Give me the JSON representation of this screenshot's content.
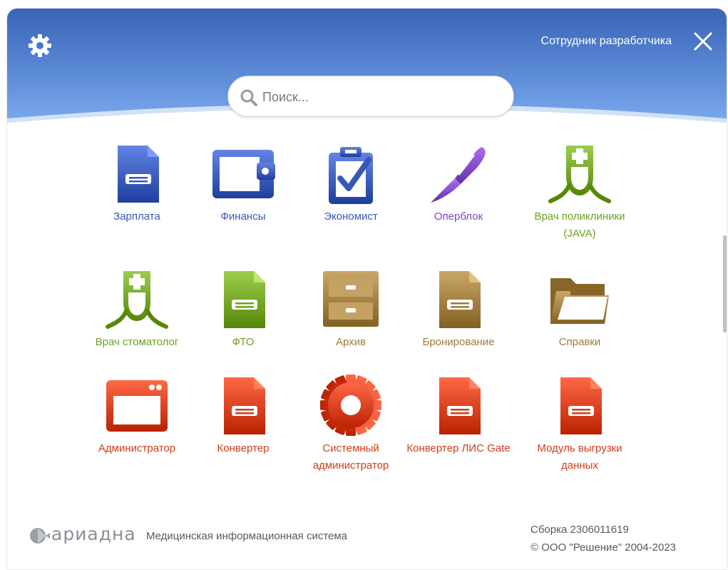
{
  "header": {
    "user_name": "Сотрудник разработчика",
    "colors": {
      "top": "#3a64b4",
      "bottom": "#7eaef0"
    }
  },
  "search": {
    "placeholder": "Поиск..."
  },
  "apps": [
    {
      "label": "Зарплата",
      "icon": "document-icon",
      "color": "#3757b8"
    },
    {
      "label": "Финансы",
      "icon": "wallet-icon",
      "color": "#3757b8"
    },
    {
      "label": "Экономист",
      "icon": "clipboard-check-icon",
      "color": "#3757b8"
    },
    {
      "label": "Оперблок",
      "icon": "scalpel-icon",
      "color": "#7d45c4"
    },
    {
      "label": "Врач поликлиники (JAVA)",
      "icon": "doctor-icon",
      "color": "#6fa01f"
    },
    {
      "label": "Врач стоматолог",
      "icon": "doctor-icon",
      "color": "#6fa01f"
    },
    {
      "label": "ФТО",
      "icon": "document-icon",
      "color": "#6fa01f"
    },
    {
      "label": "Архив",
      "icon": "cabinet-icon",
      "color": "#9c7a3c"
    },
    {
      "label": "Бронирование",
      "icon": "document-icon",
      "color": "#9c7a3c"
    },
    {
      "label": "Справки",
      "icon": "folder-icon",
      "color": "#9c7a3c"
    },
    {
      "label": "Администратор",
      "icon": "window-icon",
      "color": "#d33b1a"
    },
    {
      "label": "Конвертер",
      "icon": "document-icon",
      "color": "#d33b1a"
    },
    {
      "label": "Системный администратор",
      "icon": "gear-icon",
      "color": "#d33b1a"
    },
    {
      "label": "Конвертер ЛИС Gate",
      "icon": "document-icon",
      "color": "#d33b1a"
    },
    {
      "label": "Модуль выгрузки данных",
      "icon": "document-icon",
      "color": "#d33b1a"
    }
  ],
  "footer": {
    "brand": "ариадна",
    "subtitle": "Медицинская информационная система",
    "build": "Сборка 2306011619",
    "copyright": "© ООО \"Решение\" 2004-2023"
  }
}
